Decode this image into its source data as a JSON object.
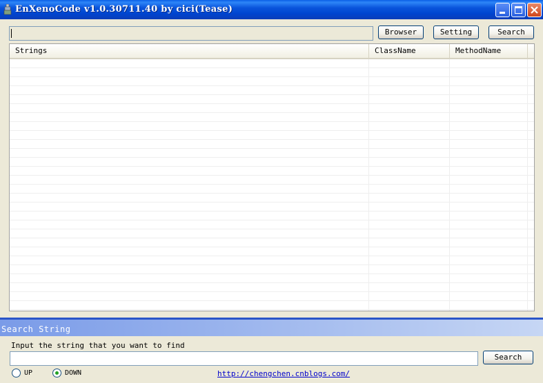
{
  "window": {
    "title": "EnXenoCode v1.0.30711.40 by cici(Tease)",
    "app_icon": "app-icon",
    "controls": [
      "minimize-icon",
      "maximize-icon",
      "close-icon"
    ]
  },
  "toolbar": {
    "path_value": "",
    "browser_label": "Browser",
    "setting_label": "Setting",
    "search_label": "Search"
  },
  "list": {
    "columns": [
      "Strings",
      "ClassName",
      "MethodName"
    ],
    "rows": []
  },
  "search_panel": {
    "title": "Search String",
    "prompt": "Input the string that you want to find",
    "input_value": "",
    "search_label": "Search",
    "direction_up": "UP",
    "direction_down": "DOWN",
    "selected_direction": "DOWN",
    "link": "http://chengchen.cnblogs.com/"
  },
  "colors": {
    "titlebar": "#0A55DC",
    "panel_header": "#7A9BE8",
    "window_bg": "#ECE9D8",
    "link": "#0000CC"
  }
}
